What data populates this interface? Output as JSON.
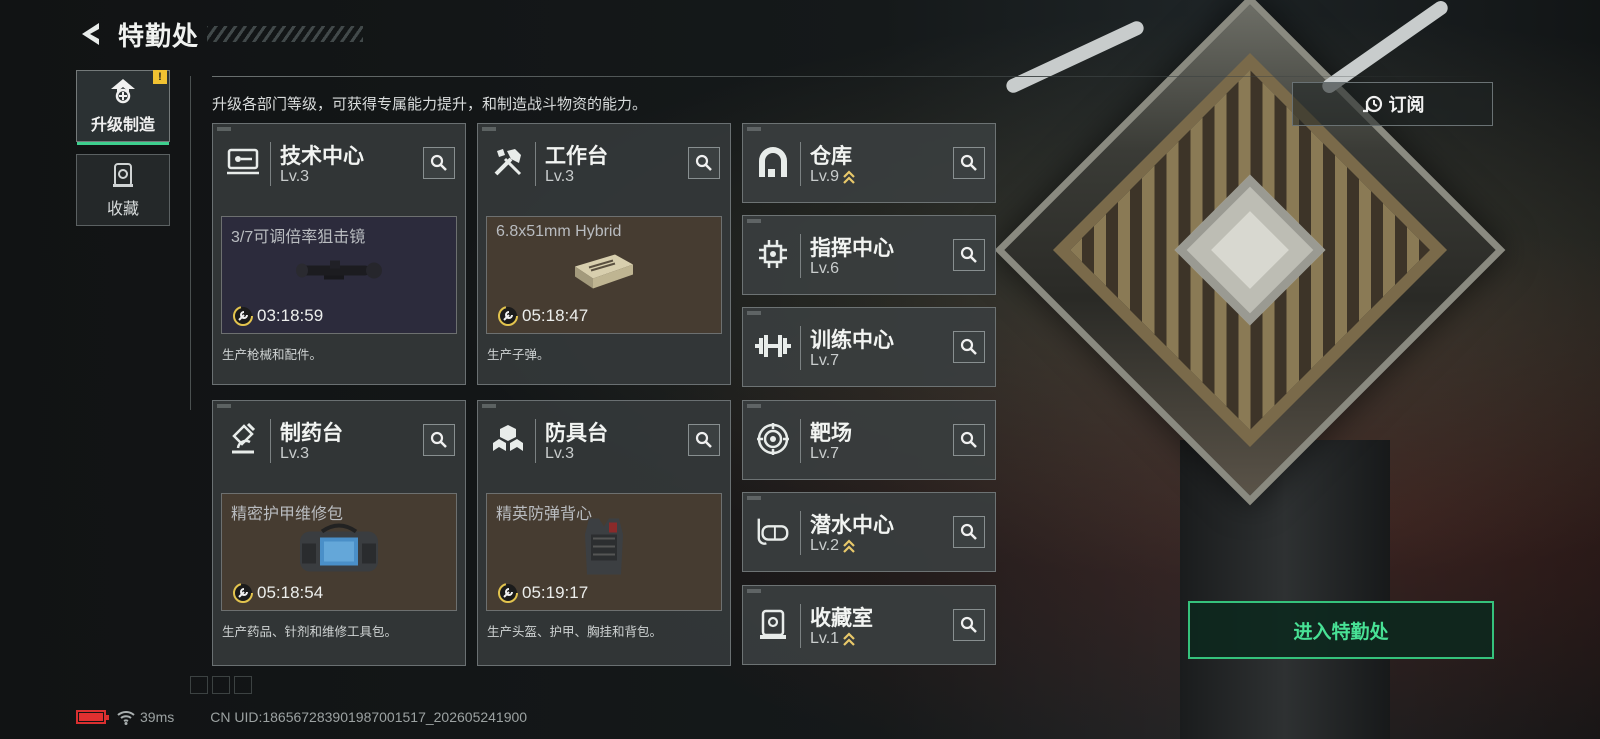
{
  "header": {
    "title": "特勤处"
  },
  "sidebar": {
    "items": [
      {
        "label": "升级制造",
        "badge": "!",
        "icon": "upgrade-icon"
      },
      {
        "label": "收藏",
        "icon": "collection-icon"
      }
    ]
  },
  "description": "升级各部门等级，可获得专属能力提升，和制造战斗物资的能力。",
  "production_cards": [
    {
      "name": "技术中心",
      "level": "Lv.3",
      "icon": "tech-center-icon",
      "product": "3/7可调倍率狙击镜",
      "timer": "03:18:59",
      "note": "生产枪械和配件。"
    },
    {
      "name": "工作台",
      "level": "Lv.3",
      "icon": "workbench-icon",
      "product": "6.8x51mm Hybrid",
      "timer": "05:18:47",
      "note": "生产子弹。"
    },
    {
      "name": "制药台",
      "level": "Lv.3",
      "icon": "pharmacy-icon",
      "product": "精密护甲维修包",
      "timer": "05:18:54",
      "note": "生产药品、针剂和维修工具包。"
    },
    {
      "name": "防具台",
      "level": "Lv.3",
      "icon": "armor-bench-icon",
      "product": "精英防弹背心",
      "timer": "05:19:17",
      "note": "生产头盔、护甲、胸挂和背包。"
    }
  ],
  "facility_cards": [
    {
      "name": "仓库",
      "level": "Lv.9",
      "upgradable": true,
      "icon": "warehouse-icon"
    },
    {
      "name": "指挥中心",
      "level": "Lv.6",
      "upgradable": false,
      "icon": "command-center-icon"
    },
    {
      "name": "训练中心",
      "level": "Lv.7",
      "upgradable": false,
      "icon": "training-center-icon"
    },
    {
      "name": "靶场",
      "level": "Lv.7",
      "upgradable": false,
      "icon": "shooting-range-icon"
    },
    {
      "name": "潜水中心",
      "level": "Lv.2",
      "upgradable": true,
      "icon": "diving-center-icon"
    },
    {
      "name": "收藏室",
      "level": "Lv.1",
      "upgradable": true,
      "icon": "collection-room-icon"
    }
  ],
  "subscribe": {
    "label": "订阅"
  },
  "enter_button": {
    "label": "进入特勤处"
  },
  "status_bar": {
    "ping": "39ms",
    "uid": "CN UID:18656728390198700151​7_202605241900"
  },
  "colors": {
    "accent": "#48e195",
    "warning": "#f1c232",
    "upgrade": "#e8c86a",
    "battery": "#e03030"
  }
}
